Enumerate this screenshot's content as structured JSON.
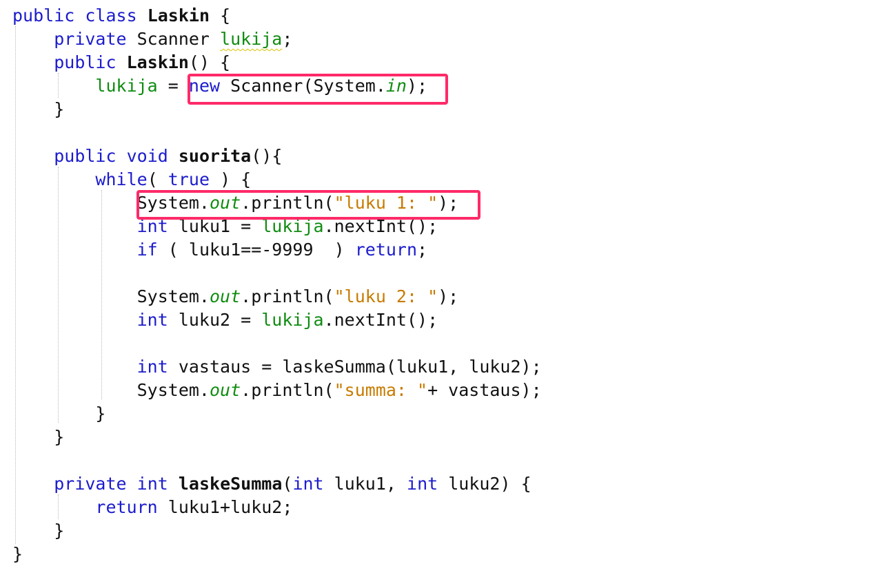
{
  "colors": {
    "keyword": "#1c1ccc",
    "field": "#0f8c10",
    "string": "#c77b00",
    "text": "#111111",
    "highlight": "#ff2a68",
    "warning_underline": "#d9c400"
  },
  "code": {
    "lines": [
      [
        {
          "t": "public",
          "c": "kw"
        },
        {
          "t": " "
        },
        {
          "t": "class",
          "c": "kw"
        },
        {
          "t": " "
        },
        {
          "t": "Laskin",
          "c": "bold"
        },
        {
          "t": " {"
        }
      ],
      [
        {
          "t": "    "
        },
        {
          "t": "private",
          "c": "kw"
        },
        {
          "t": " Scanner "
        },
        {
          "t": "lukija",
          "c": "fld",
          "u": true
        },
        {
          "t": ";"
        }
      ],
      [
        {
          "t": "    "
        },
        {
          "t": "public",
          "c": "kw"
        },
        {
          "t": " "
        },
        {
          "t": "Laskin",
          "c": "bold"
        },
        {
          "t": "() {"
        }
      ],
      [
        {
          "t": "        "
        },
        {
          "t": "lukija",
          "c": "fld"
        },
        {
          "t": " = "
        },
        {
          "t": "new",
          "c": "kw"
        },
        {
          "t": " Scanner(System."
        },
        {
          "t": "in",
          "c": "sfi"
        },
        {
          "t": ");"
        }
      ],
      [
        {
          "t": "    }"
        }
      ],
      [],
      [
        {
          "t": "    "
        },
        {
          "t": "public",
          "c": "kw"
        },
        {
          "t": " "
        },
        {
          "t": "void",
          "c": "kw"
        },
        {
          "t": " "
        },
        {
          "t": "suorita",
          "c": "bold"
        },
        {
          "t": "(){"
        }
      ],
      [
        {
          "t": "        "
        },
        {
          "t": "while",
          "c": "kw"
        },
        {
          "t": "( "
        },
        {
          "t": "true",
          "c": "kw"
        },
        {
          "t": " ) {"
        }
      ],
      [
        {
          "t": "            System."
        },
        {
          "t": "out",
          "c": "sfi"
        },
        {
          "t": ".println("
        },
        {
          "t": "\"luku 1: \"",
          "c": "str"
        },
        {
          "t": ");"
        }
      ],
      [
        {
          "t": "            "
        },
        {
          "t": "int",
          "c": "kw"
        },
        {
          "t": " luku1 = "
        },
        {
          "t": "lukija",
          "c": "fld"
        },
        {
          "t": ".nextInt();"
        }
      ],
      [
        {
          "t": "            "
        },
        {
          "t": "if",
          "c": "kw"
        },
        {
          "t": " ( luku1==-9999  ) "
        },
        {
          "t": "return",
          "c": "kw"
        },
        {
          "t": ";"
        }
      ],
      [],
      [
        {
          "t": "            System."
        },
        {
          "t": "out",
          "c": "sfi"
        },
        {
          "t": ".println("
        },
        {
          "t": "\"luku 2: \"",
          "c": "str"
        },
        {
          "t": ");"
        }
      ],
      [
        {
          "t": "            "
        },
        {
          "t": "int",
          "c": "kw"
        },
        {
          "t": " luku2 = "
        },
        {
          "t": "lukija",
          "c": "fld"
        },
        {
          "t": ".nextInt();"
        }
      ],
      [],
      [
        {
          "t": "            "
        },
        {
          "t": "int",
          "c": "kw"
        },
        {
          "t": " vastaus = laskeSumma(luku1, luku2);"
        }
      ],
      [
        {
          "t": "            System."
        },
        {
          "t": "out",
          "c": "sfi"
        },
        {
          "t": ".println("
        },
        {
          "t": "\"summa: \"",
          "c": "str"
        },
        {
          "t": "+ vastaus);"
        }
      ],
      [
        {
          "t": "        }"
        }
      ],
      [
        {
          "t": "    }"
        }
      ],
      [],
      [
        {
          "t": "    "
        },
        {
          "t": "private",
          "c": "kw"
        },
        {
          "t": " "
        },
        {
          "t": "int",
          "c": "kw"
        },
        {
          "t": " "
        },
        {
          "t": "laskeSumma",
          "c": "bold"
        },
        {
          "t": "("
        },
        {
          "t": "int",
          "c": "kw"
        },
        {
          "t": " luku1, "
        },
        {
          "t": "int",
          "c": "kw"
        },
        {
          "t": " luku2) {"
        }
      ],
      [
        {
          "t": "        "
        },
        {
          "t": "return",
          "c": "kw"
        },
        {
          "t": " luku1+luku2;"
        }
      ],
      [
        {
          "t": "    }"
        }
      ],
      [
        {
          "t": "}"
        }
      ]
    ]
  }
}
